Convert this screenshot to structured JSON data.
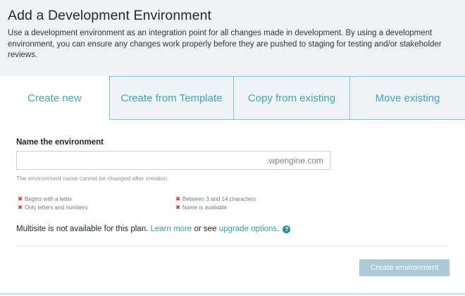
{
  "header": {
    "title": "Add a Development Environment",
    "description": "Use a development environment as an integration point for all changes made in development. By using a development environment, you can ensure any changes work properly before they are pushed to staging for testing and/or stakeholder reviews."
  },
  "tabs": [
    {
      "label": "Create new",
      "active": true
    },
    {
      "label": "Create from Template",
      "active": false
    },
    {
      "label": "Copy from existing",
      "active": false
    },
    {
      "label": "Move existing",
      "active": false
    }
  ],
  "form": {
    "section_title": "Name the environment",
    "name_value": "",
    "domain_suffix": ".wpengine.com",
    "help_text": "The environment name cannot be changed after creation.",
    "rules": [
      {
        "label": "Begins with a letter",
        "status": "failed"
      },
      {
        "label": "Only letters and numbers",
        "status": "failed"
      },
      {
        "label": "Between 3 and 14 characters",
        "status": "failed"
      },
      {
        "label": "Name is available",
        "status": "failed"
      }
    ],
    "rule_fail_mark": "✖",
    "multisite": {
      "prefix": "Multisite is not available for this plan.",
      "learn_more": "Learn more",
      "middle": "or see",
      "upgrade": "upgrade options",
      "suffix": ".",
      "help_icon": "?"
    },
    "submit_label": "Create environment"
  },
  "colors": {
    "accent": "#3ca8b8",
    "header_bg": "#eef3f6",
    "error": "#d63638",
    "button_disabled": "#a9c9d4"
  },
  "icons": {
    "rule_fail": "x-mark-icon",
    "help": "question-circle-icon"
  }
}
